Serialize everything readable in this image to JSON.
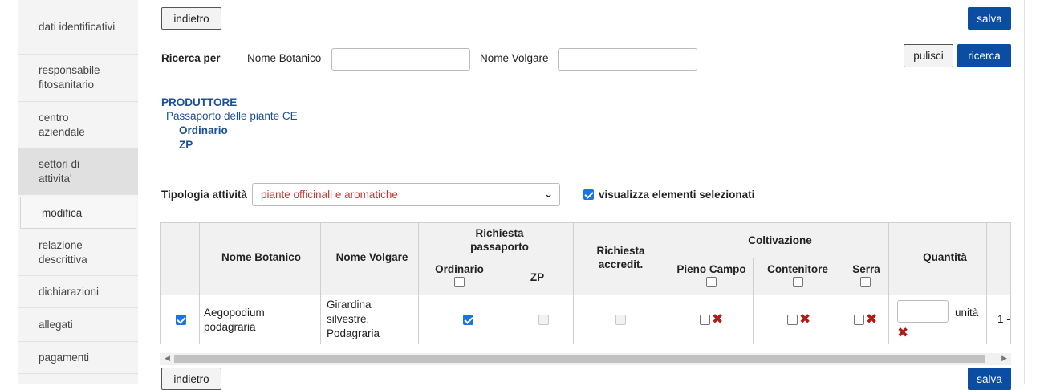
{
  "sidebar": {
    "items": [
      {
        "label": "dati identificativi"
      },
      {
        "label": "responsabile fitosanitario"
      },
      {
        "label": "centro aziendale"
      },
      {
        "label": "settori di attivita'"
      },
      {
        "label": "modifica"
      },
      {
        "label": "relazione descrittiva"
      },
      {
        "label": "dichiarazioni"
      },
      {
        "label": "allegati"
      },
      {
        "label": "pagamenti"
      }
    ]
  },
  "toolbar": {
    "back_label": "indietro",
    "save_label": "salva",
    "clear_label": "pulisci",
    "search_label": "ricerca"
  },
  "search": {
    "title": "Ricerca per",
    "botanical_label": "Nome Botanico",
    "botanical_value": "",
    "common_label": "Nome Volgare",
    "common_value": ""
  },
  "tree": {
    "root": "PRODUTTORE",
    "child": "Passaporto delle piante CE",
    "leaf1": "Ordinario",
    "leaf2": "ZP"
  },
  "filter": {
    "label": "Tipologia attività",
    "selected": "piante officinali e aromatiche",
    "show_selected_label": "visualizza elementi selezionati",
    "show_selected_checked": true
  },
  "table": {
    "headers": {
      "botanical": "Nome Botanico",
      "common": "Nome Volgare",
      "passport": "Richiesta passaporto",
      "ordinary": "Ordinario",
      "zp": "ZP",
      "accredit": "Richiesta accredit.",
      "cultivation": "Coltivazione",
      "open_field": "Pieno Campo",
      "container": "Contenitore",
      "greenhouse": "Serra",
      "quantity": "Quantità"
    },
    "rows": [
      {
        "selected": true,
        "botanical": "Aegopodium podagraria",
        "common": "Girardina silvestre, Podagraria",
        "ordinary": true,
        "zp": false,
        "accredit": false,
        "quantity_value": "",
        "quantity_unit": "unità",
        "extra": "1 -"
      }
    ]
  },
  "colors": {
    "primary": "#0a4da2",
    "tree_text": "#1d4f94",
    "select_text": "#c93535",
    "delete_icon": "#b21a1a"
  }
}
